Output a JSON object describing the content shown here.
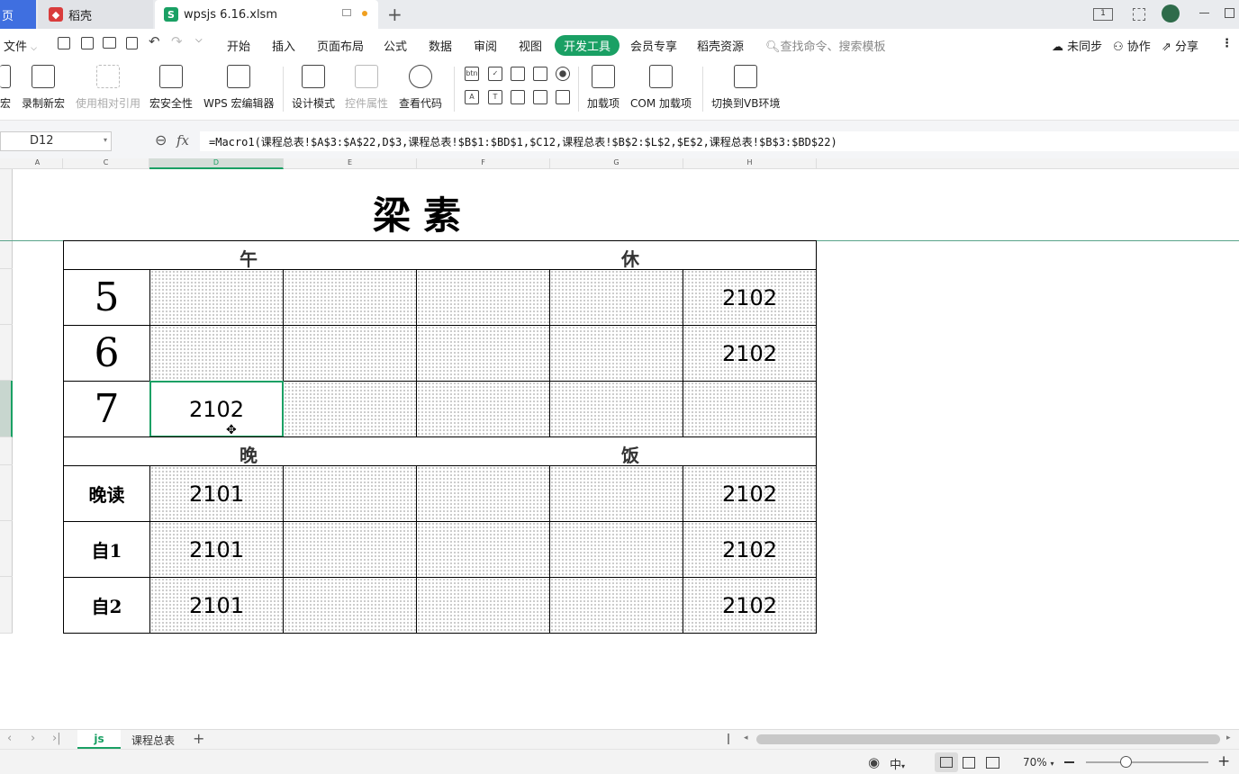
{
  "titlebar": {
    "home_tab": "页",
    "daoke_tab": "稻壳",
    "file_tab": "wpsjs 6.16.xlsm",
    "new_tab": "+"
  },
  "menubar": {
    "file": "文件",
    "items": [
      "开始",
      "插入",
      "页面布局",
      "公式",
      "数据",
      "审阅",
      "视图",
      "开发工具",
      "会员专享",
      "稻壳资源"
    ],
    "search": "查找命令、搜索模板",
    "sync": "未同步",
    "collab": "协作",
    "share": "分享"
  },
  "ribbon": {
    "macro": "宏",
    "record": "录制新宏",
    "relative": "使用相对引用",
    "security": "宏安全性",
    "editor": "WPS 宏编辑器",
    "design": "设计模式",
    "props": "控件属性",
    "code": "查看代码",
    "addins": "加载项",
    "com": "COM 加载项",
    "vb": "切换到VB环境"
  },
  "formula_bar": {
    "name_box": "D12",
    "fx": "fx",
    "formula": "=Macro1(课程总表!$A$3:$A$22,D$3,课程总表!$B$1:$BD$1,$C12,课程总表!$B$2:$L$2,$E$2,课程总表!$B$3:$BD$22)"
  },
  "columns": [
    "A",
    "C",
    "D",
    "E",
    "F",
    "G",
    "H"
  ],
  "sheet": {
    "title": "梁素",
    "noon_left": "午",
    "noon_right": "休",
    "dinner_left": "晚",
    "dinner_right": "饭",
    "rows": [
      {
        "label": "5",
        "cells": [
          "",
          "",
          "",
          "",
          "2102"
        ]
      },
      {
        "label": "6",
        "cells": [
          "",
          "",
          "",
          "",
          "2102"
        ]
      },
      {
        "label": "7",
        "cells": [
          "2102",
          "",
          "",
          "",
          ""
        ]
      },
      {
        "label": "晚读",
        "cells": [
          "2101",
          "",
          "",
          "",
          "2102"
        ]
      },
      {
        "label": "自1",
        "cells": [
          "2101",
          "",
          "",
          "",
          "2102"
        ]
      },
      {
        "label": "自2",
        "cells": [
          "2101",
          "",
          "",
          "",
          "2102"
        ]
      }
    ]
  },
  "sheet_tabs": {
    "active": "js",
    "other": "课程总表",
    "add": "+"
  },
  "status": {
    "zoom": "70%",
    "ime": "中"
  }
}
